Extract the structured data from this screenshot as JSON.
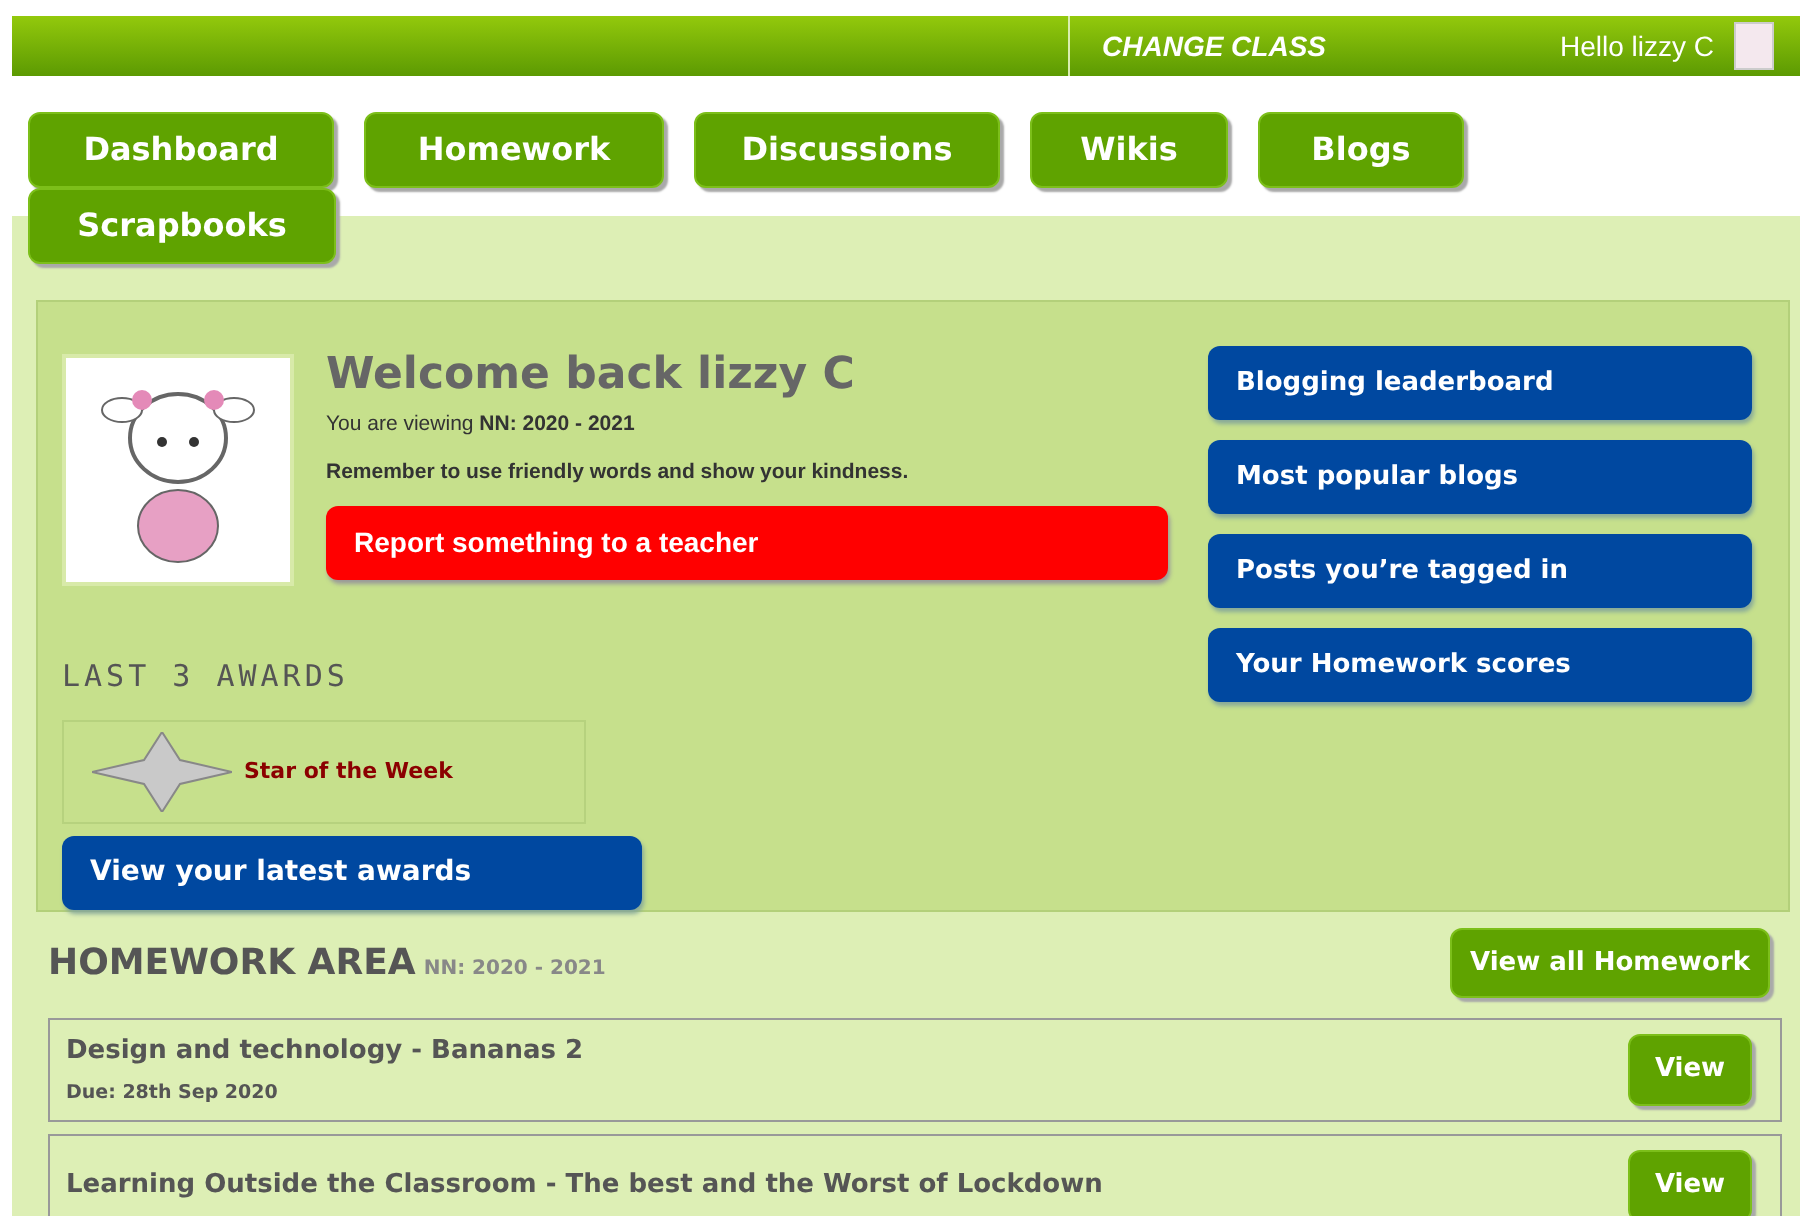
{
  "top_bar": {
    "change_class": "CHANGE CLASS",
    "greeting": "Hello lizzy C"
  },
  "tabs": [
    {
      "label": "Dashboard"
    },
    {
      "label": "Homework"
    },
    {
      "label": "Discussions"
    },
    {
      "label": "Wikis"
    },
    {
      "label": "Blogs"
    },
    {
      "label": "Scrapbooks"
    }
  ],
  "welcome": {
    "title": "Welcome back lizzy C",
    "viewing": "You are viewing **NN: 2020 - 2021**",
    "reminder": "Remember to use friendly words and show your kindness.",
    "report_button": "Report something to a teacher"
  },
  "side_links": [
    "Blogging leaderboard",
    "Most popular blogs",
    "Posts you’re tagged in",
    "Your Homework scores"
  ],
  "awards": {
    "heading": "LAST 3 AWARDS",
    "items": [
      "Star of the Week"
    ],
    "button": "View your latest awards"
  },
  "homework": {
    "heading": "HOMEWORK AREA",
    "class_label": "NN: 2020 - 2021",
    "view_all": "View all Homework",
    "items": [
      {
        "title": "Design and technology - Bananas 2",
        "due": "Due: 28th Sep 2020",
        "button": "View"
      },
      {
        "title": "Learning Outside the Classroom - The best and the Worst of Lockdown",
        "button": "View"
      }
    ]
  }
}
